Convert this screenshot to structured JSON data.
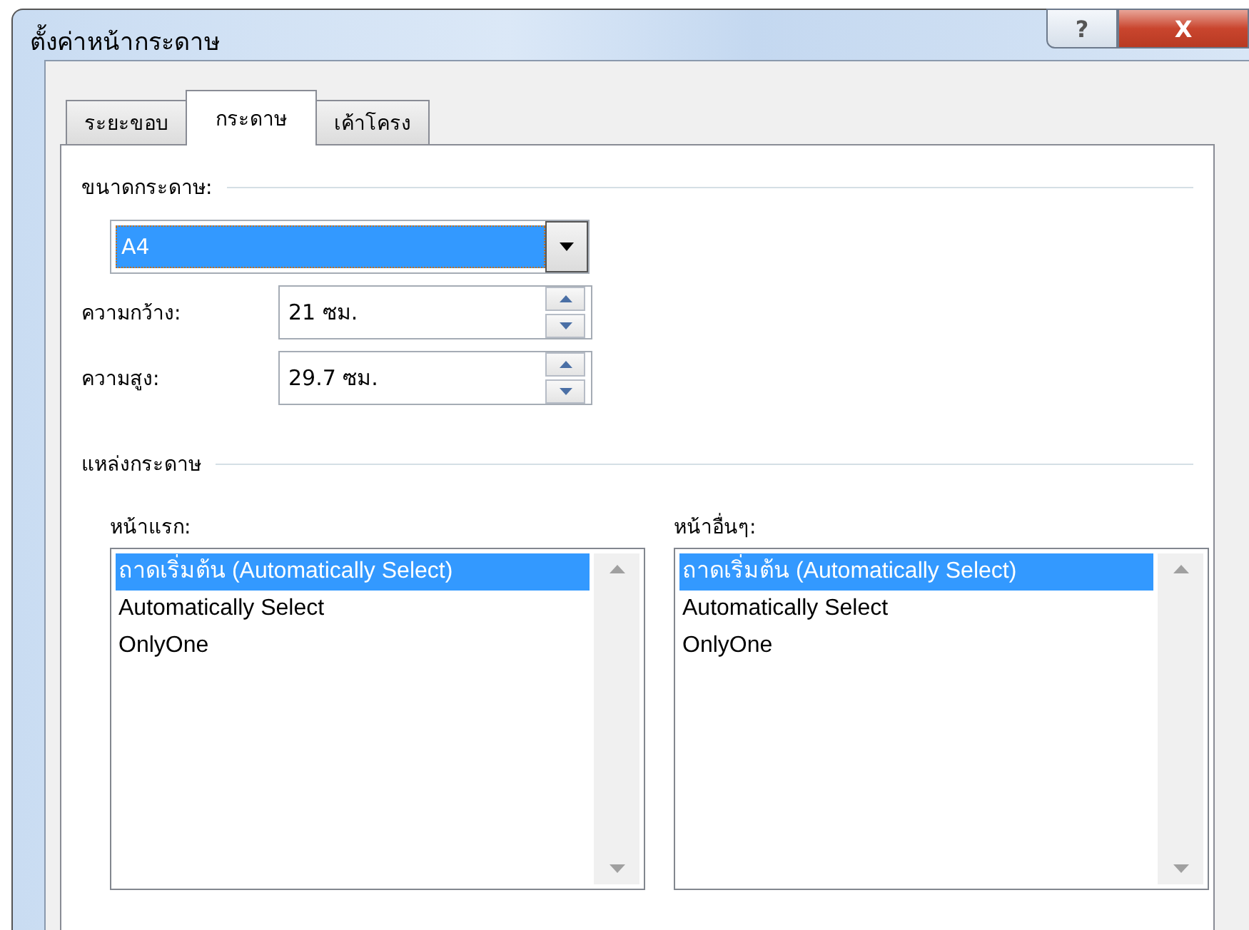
{
  "window": {
    "title": "ตั้งค่าหน้ากระดาษ",
    "buttons": [
      {
        "kind": "help",
        "label": "?"
      },
      {
        "kind": "close",
        "label": "X"
      }
    ]
  },
  "tabs": [
    {
      "label": "ระยะขอบ",
      "selected": false
    },
    {
      "label": "กระดาษ",
      "selected": true
    },
    {
      "label": "เค้าโครง",
      "selected": false
    }
  ],
  "paper_size": {
    "heading": "ขนาดกระดาษ:",
    "value": "A4",
    "width": {
      "label": "ความกว้าง:",
      "value": "21 ซม."
    },
    "height": {
      "label": "ความสูง:",
      "value": "29.7 ซม."
    }
  },
  "paper_source": {
    "heading": "แหล่งกระดาษ",
    "lists": [
      {
        "label": "หน้าแรก:",
        "items": [
          {
            "text": "ถาดเริ่มต้น (Automatically Select)",
            "selected": true
          },
          {
            "text": "Automatically Select",
            "selected": false
          },
          {
            "text": "OnlyOne",
            "selected": false
          }
        ]
      },
      {
        "label": "หน้าอื่นๆ:",
        "items": [
          {
            "text": "ถาดเริ่มต้น (Automatically Select)",
            "selected": true
          },
          {
            "text": "Automatically Select",
            "selected": false
          },
          {
            "text": "OnlyOne",
            "selected": false
          }
        ]
      }
    ]
  }
}
